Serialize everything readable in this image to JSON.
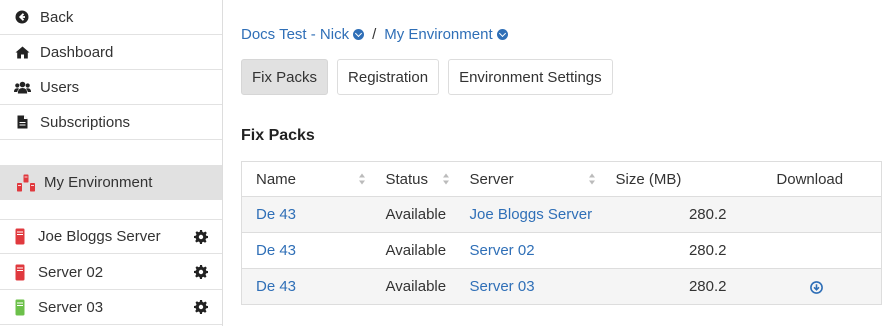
{
  "sidebar": {
    "nav": [
      {
        "label": "Back",
        "icon": "back-circle-icon"
      },
      {
        "label": "Dashboard",
        "icon": "home-icon"
      },
      {
        "label": "Users",
        "icon": "users-icon"
      },
      {
        "label": "Subscriptions",
        "icon": "document-icon"
      }
    ],
    "environment": {
      "label": "My Environment",
      "icon": "servers-icon"
    },
    "servers": [
      {
        "label": "Joe Bloggs Server",
        "color": "#e0393e"
      },
      {
        "label": "Server 02",
        "color": "#e0393e"
      },
      {
        "label": "Server 03",
        "color": "#6cc04a"
      }
    ]
  },
  "breadcrumb": {
    "org": "Docs Test - Nick",
    "separator": "/",
    "env": "My Environment"
  },
  "tabs": [
    "Fix Packs",
    "Registration",
    "Environment Settings"
  ],
  "section_title": "Fix Packs",
  "table": {
    "headers": [
      "Name",
      "Status",
      "Server",
      "Size (MB)",
      "Download"
    ],
    "rows": [
      {
        "name": "De 43",
        "status": "Available",
        "server": "Joe Bloggs Server",
        "size": "280.2",
        "download": false
      },
      {
        "name": "De 43",
        "status": "Available",
        "server": "Server 02",
        "size": "280.2",
        "download": false
      },
      {
        "name": "De 43",
        "status": "Available",
        "server": "Server 03",
        "size": "280.2",
        "download": true
      }
    ]
  },
  "colors": {
    "link": "#2f6fb7",
    "active_bg": "#e1e1e1"
  }
}
